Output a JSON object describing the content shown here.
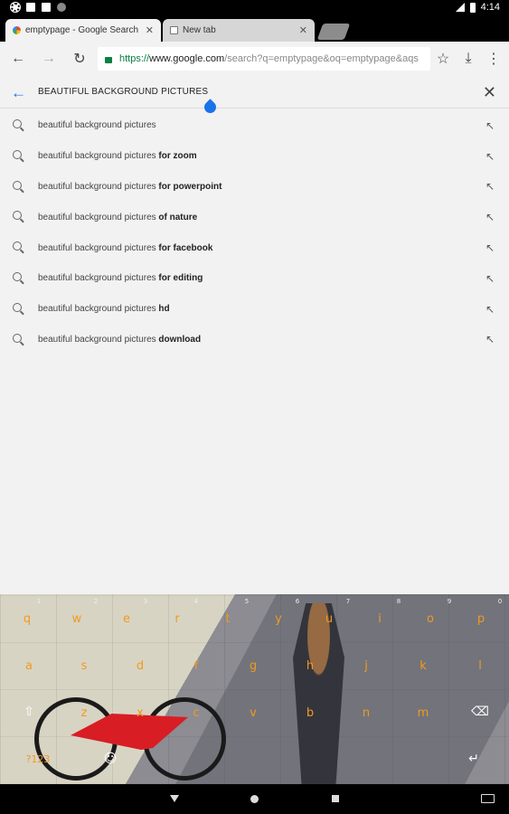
{
  "status_bar": {
    "time": "4:14"
  },
  "tabs": [
    {
      "title": "emptypage - Google Search",
      "close": "✕"
    },
    {
      "title": "New tab",
      "close": "✕"
    }
  ],
  "toolbar": {
    "back": "←",
    "forward": "→",
    "reload": "↻",
    "url_scheme": "https://",
    "url_domain": "www.google.com",
    "url_path": "/search?q=emptypage&oq=emptypage&aqs",
    "star": "☆",
    "download": "⤓",
    "menu": "⋮"
  },
  "search": {
    "query": "BEAUTIFUL  BACKGROUND PICTURES",
    "back": "←",
    "clear": "✕"
  },
  "suggestions": [
    {
      "base": "beautiful background pictures",
      "suffix": ""
    },
    {
      "base": "beautiful background pictures ",
      "suffix": "for zoom"
    },
    {
      "base": "beautiful background pictures ",
      "suffix": "for powerpoint"
    },
    {
      "base": "beautiful background pictures ",
      "suffix": "of nature"
    },
    {
      "base": "beautiful background pictures ",
      "suffix": "for facebook"
    },
    {
      "base": "beautiful background pictures ",
      "suffix": "for editing"
    },
    {
      "base": "beautiful background pictures ",
      "suffix": "hd"
    },
    {
      "base": "beautiful background pictures ",
      "suffix": "download"
    }
  ],
  "suggestion_arrow": "↖",
  "keyboard": {
    "row1": [
      "q",
      "w",
      "e",
      "r",
      "t",
      "y",
      "u",
      "i",
      "o",
      "p"
    ],
    "row1_nums": [
      "1",
      "2",
      "3",
      "4",
      "5",
      "6",
      "7",
      "8",
      "9",
      "0"
    ],
    "row2": [
      "a",
      "s",
      "d",
      "f",
      "g",
      "h",
      "j",
      "k",
      "l"
    ],
    "row3": [
      "z",
      "x",
      "c",
      "v",
      "b",
      "n",
      "m"
    ],
    "shift": "⇧",
    "backspace": "⌫",
    "symbols": "?123",
    "emoji": "☺",
    "space": "",
    "enter": "↵"
  },
  "colors": {
    "accent": "#1a73e8",
    "url_green": "#0b8043",
    "key_orange": "#f19a1e"
  }
}
